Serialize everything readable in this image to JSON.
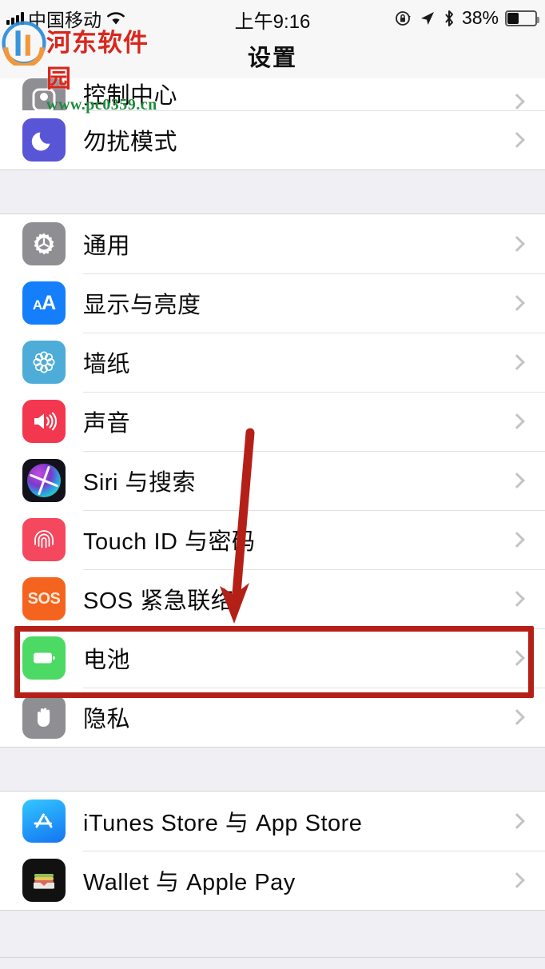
{
  "status_bar": {
    "carrier": "中国移动",
    "signal_icon": "signal-bars-icon",
    "wifi_icon": "wifi-icon",
    "time": "上午9:16",
    "rotation_lock_icon": "rotation-lock-icon",
    "location_icon": "location-arrow-icon",
    "bluetooth_icon": "bluetooth-icon",
    "battery_percent": "38%",
    "battery_icon": "battery-icon"
  },
  "watermark": {
    "title": "河东软件园",
    "url": "www.pc0359.cn",
    "title_color": "#D9261C",
    "url_color": "#1F8A3B"
  },
  "navbar": {
    "title": "设置"
  },
  "groups": [
    {
      "id": "group-notifications",
      "rows": [
        {
          "label": "控制中心",
          "icon": "control-center-icon",
          "icon_class": "ic-controlcenter",
          "clipped": true
        },
        {
          "label": "勿扰模式",
          "icon": "do-not-disturb-moon-icon",
          "icon_class": "ic-dnd",
          "clipped": false
        }
      ]
    },
    {
      "id": "group-system",
      "rows": [
        {
          "label": "通用",
          "icon": "gear-icon",
          "icon_class": "ic-general",
          "clipped": false
        },
        {
          "label": "显示与亮度",
          "icon": "display-brightness-aa-icon",
          "icon_class": "ic-display",
          "clipped": false
        },
        {
          "label": "墙纸",
          "icon": "wallpaper-flower-icon",
          "icon_class": "ic-wallpaper",
          "clipped": false
        },
        {
          "label": "声音",
          "icon": "speaker-icon",
          "icon_class": "ic-sounds",
          "clipped": false
        },
        {
          "label": "Siri 与搜索",
          "icon": "siri-orb-icon",
          "icon_class": "ic-siri",
          "clipped": false
        },
        {
          "label": "Touch ID 与密码",
          "icon": "fingerprint-icon",
          "icon_class": "ic-touchid",
          "clipped": false
        },
        {
          "label": "SOS 紧急联络",
          "icon": "sos-icon",
          "icon_class": "ic-sos",
          "clipped": false
        },
        {
          "label": "电池",
          "icon": "battery-icon",
          "icon_class": "ic-battery",
          "clipped": false,
          "highlighted": true
        },
        {
          "label": "隐私",
          "icon": "hand-privacy-icon",
          "icon_class": "ic-privacy",
          "clipped": false
        }
      ]
    },
    {
      "id": "group-stores",
      "rows": [
        {
          "label": "iTunes Store 与 App Store",
          "icon": "app-store-icon",
          "icon_class": "ic-appstore",
          "clipped": false
        },
        {
          "label": "Wallet 与 Apple Pay",
          "icon": "wallet-icon",
          "icon_class": "ic-wallet",
          "clipped": false
        }
      ]
    }
  ],
  "annotations": {
    "arrow_color": "#B42018",
    "highlight_box_color": "#B42018",
    "highlight_target": "电池"
  }
}
